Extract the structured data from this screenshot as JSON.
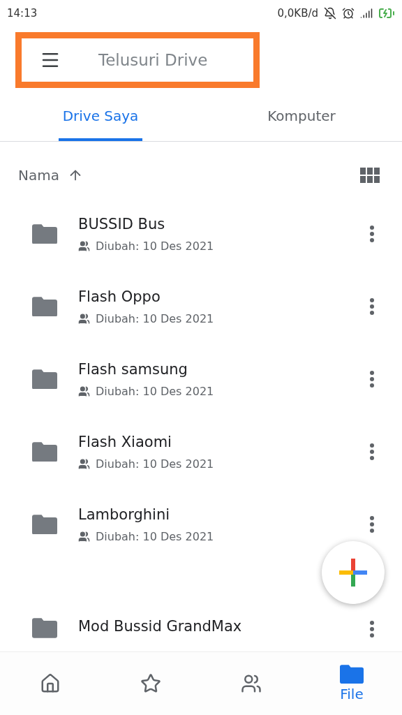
{
  "status_bar": {
    "time": "14:13",
    "data_rate": "0,0KB/d"
  },
  "search": {
    "placeholder": "Telusuri Drive",
    "highlighted": true
  },
  "tabs": [
    {
      "label": "Drive Saya",
      "selected": true
    },
    {
      "label": "Komputer",
      "selected": false
    }
  ],
  "sort": {
    "label": "Nama"
  },
  "files": [
    {
      "name": "BUSSID Bus",
      "meta": "Diubah: 10 Des 2021"
    },
    {
      "name": "Flash Oppo",
      "meta": "Diubah: 10 Des 2021"
    },
    {
      "name": "Flash samsung",
      "meta": "Diubah: 10 Des 2021"
    },
    {
      "name": "Flash Xiaomi",
      "meta": "Diubah: 10 Des 2021"
    },
    {
      "name": "Lamborghini",
      "meta": "Diubah: 10 Des 2021"
    },
    {
      "name": "Mod Bussid GrandMax"
    }
  ],
  "bottom_nav": [
    {
      "kind": "home",
      "selected": false
    },
    {
      "kind": "starred",
      "selected": false
    },
    {
      "kind": "shared",
      "selected": false
    },
    {
      "kind": "files",
      "label": "File",
      "selected": true
    }
  ]
}
